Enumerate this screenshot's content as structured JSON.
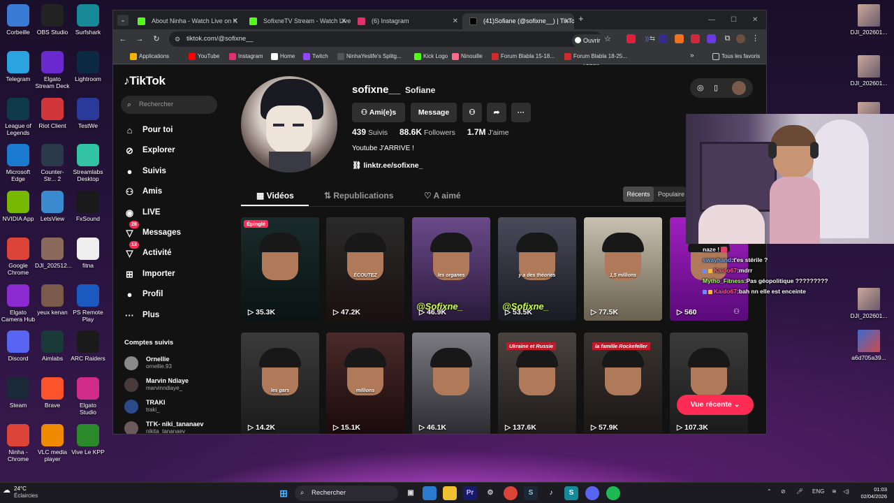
{
  "desktop_left": [
    {
      "label": "Corbeille",
      "icon": "trash-icon",
      "color": "#3a7bd5"
    },
    {
      "label": "OBS Studio",
      "icon": "obs-icon",
      "color": "#222"
    },
    {
      "label": "Surfshark",
      "icon": "surfshark-icon",
      "color": "#178a9a"
    },
    {
      "label": "Telegram",
      "icon": "telegram-icon",
      "color": "#2aa3e0"
    },
    {
      "label": "Elgato Stream Deck",
      "icon": "stream-deck-icon",
      "color": "#6a2ad0"
    },
    {
      "label": "Lightroom",
      "icon": "lightroom-icon",
      "color": "#0c2a44"
    },
    {
      "label": "League of Legends",
      "icon": "league-icon",
      "color": "#0e3a4a"
    },
    {
      "label": "Riot Client",
      "icon": "riot-icon",
      "color": "#d13639"
    },
    {
      "label": "TestWe",
      "icon": "testwe-icon",
      "color": "#2a3a9a"
    },
    {
      "label": "Microsoft Edge",
      "icon": "edge-icon",
      "color": "#1a7ad0"
    },
    {
      "label": "Counter-Str... 2",
      "icon": "cs2-icon",
      "color": "#2a3a4a"
    },
    {
      "label": "Streamlabs Desktop",
      "icon": "streamlabs-icon",
      "color": "#31c3a2"
    },
    {
      "label": "NVIDIA App",
      "icon": "nvidia-icon",
      "color": "#76b900"
    },
    {
      "label": "LetsView",
      "icon": "letsview-icon",
      "color": "#3a8ad0"
    },
    {
      "label": "FxSound",
      "icon": "fxsound-icon",
      "color": "#1a1a1a"
    },
    {
      "label": "Google Chrome",
      "icon": "chrome-icon",
      "color": "#dc4437"
    },
    {
      "label": "DJI_202512...",
      "icon": "image-file-icon",
      "color": "#8a6a5a"
    },
    {
      "label": "fitna",
      "icon": "text-file-icon",
      "color": "#eeeeee"
    },
    {
      "label": "Elgato Camera Hub",
      "icon": "camera-hub-icon",
      "color": "#8a2ad0"
    },
    {
      "label": "yeux kenan",
      "icon": "image-file-icon",
      "color": "#7a5a4a"
    },
    {
      "label": "PS Remote Play",
      "icon": "ps-remote-icon",
      "color": "#1a5ac0"
    },
    {
      "label": "Discord",
      "icon": "discord-icon",
      "color": "#5865f2"
    },
    {
      "label": "Aimlabs",
      "icon": "aimlabs-icon",
      "color": "#1a3a3a"
    },
    {
      "label": "ARC Raiders",
      "icon": "arc-raiders-icon",
      "color": "#1a1a1a"
    },
    {
      "label": "Steam",
      "icon": "steam-icon",
      "color": "#1b2838"
    },
    {
      "label": "Brave",
      "icon": "brave-icon",
      "color": "#fb542b"
    },
    {
      "label": "Elgato Studio",
      "icon": "elgato-studio-icon",
      "color": "#d02a8a"
    },
    {
      "label": "Ninha - Chrome",
      "icon": "chrome-icon",
      "color": "#dc4437"
    },
    {
      "label": "VLC media player",
      "icon": "vlc-icon",
      "color": "#f08a00"
    },
    {
      "label": "Vive Le KPP",
      "icon": "kpp-icon",
      "color": "#2a8a2a"
    }
  ],
  "desktop_right": [
    {
      "label": "DJI_202601..."
    },
    {
      "label": "DJI_202601..."
    },
    {
      "label": "DJI_202601..."
    },
    {
      "label": "DJI_202601..."
    },
    {
      "label": "a6d705a39..."
    }
  ],
  "browser": {
    "tabs": [
      {
        "title": "About Ninha - Watch Live on K",
        "color": "#53fc18"
      },
      {
        "title": "SofixneTV Stream - Watch Live",
        "color": "#53fc18"
      },
      {
        "title": "(6) Instagram",
        "color": "#e1306c"
      },
      {
        "title": "(41)Sofiane (@sofixne__) | TikTo",
        "color": "#000000"
      }
    ],
    "new_tab": "+",
    "url": "tiktok.com/@sofixne__",
    "open_app": "Ouvrir dans l'appli",
    "bookmarks": [
      {
        "label": "Applications",
        "color": "#f4b400"
      },
      {
        "label": "YouTube",
        "color": "#ff0000"
      },
      {
        "label": "Instagram",
        "color": "#e1306c"
      },
      {
        "label": "Home",
        "color": "#ffffff"
      },
      {
        "label": "Twitch",
        "color": "#9146ff"
      },
      {
        "label": "NinhaYeslife's Splitg...",
        "color": "#555555"
      },
      {
        "label": "Kick Logo",
        "color": "#53fc18"
      },
      {
        "label": "Ninouille",
        "color": "#ff6a8a"
      },
      {
        "label": "Forum Blabla 15-18...",
        "color": "#d02a2a"
      },
      {
        "label": "Forum Blabla 18-25...",
        "color": "#d02a2a"
      }
    ],
    "all_bookmarks": "Tous les favoris"
  },
  "tiktok": {
    "logo": "TikTok",
    "search_placeholder": "Rechercher",
    "nav": [
      {
        "label": "Pour toi",
        "icon": "home-icon"
      },
      {
        "label": "Explorer",
        "icon": "compass-icon"
      },
      {
        "label": "Suivis",
        "icon": "following-icon"
      },
      {
        "label": "Amis",
        "icon": "friends-icon"
      },
      {
        "label": "LIVE",
        "icon": "live-icon"
      },
      {
        "label": "Messages",
        "icon": "messages-icon",
        "badge": "28"
      },
      {
        "label": "Activité",
        "icon": "activity-icon",
        "badge": "13"
      },
      {
        "label": "Importer",
        "icon": "upload-icon"
      },
      {
        "label": "Profil",
        "icon": "profile-icon"
      },
      {
        "label": "Plus",
        "icon": "more-icon"
      }
    ],
    "followed_title": "Comptes suivis",
    "followed": [
      {
        "name": "Ornellie",
        "handle": "ornellie.93"
      },
      {
        "name": "Marvin Ndiaye",
        "handle": "marvinndiaye_"
      },
      {
        "name": "TRAKI",
        "handle": "traki_"
      },
      {
        "name": "TΓK- niki_tananaev",
        "handle": "nikita_tananaev"
      }
    ],
    "profile": {
      "username": "sofixne__",
      "nickname": "Sofiane",
      "friends_btn": "Ami(e)s",
      "message_btn": "Message",
      "following_count": "439",
      "following_label": "Suivis",
      "followers_count": "88.6K",
      "followers_label": "Followers",
      "likes_count": "1.7M",
      "likes_label": "J'aime",
      "bio": "Youtube J'ARRIVE !",
      "link": "linktr.ee/sofixne_"
    },
    "tabs": {
      "videos": "Vidéos",
      "reposts": "Republications",
      "liked": "A aimé"
    },
    "sort": {
      "recent": "Récents",
      "popular": "Populaire"
    },
    "videos": [
      {
        "views": "35.3K",
        "tag": "Épinglé",
        "caption": ""
      },
      {
        "views": "47.2K",
        "tag": "",
        "caption": "ÉCOUTEZ"
      },
      {
        "views": "46.9K",
        "tag": "",
        "caption": "les organes",
        "overlay": "@Sofixne_"
      },
      {
        "views": "53.5K",
        "tag": "",
        "caption": "y a des théories",
        "overlay": "@Sofixne_"
      },
      {
        "views": "77.5K",
        "tag": "",
        "caption": "1,5 millions"
      },
      {
        "views": "560",
        "tag": "",
        "caption": ""
      },
      {
        "views": "14.2K",
        "tag": "",
        "caption": "les gars"
      },
      {
        "views": "15.1K",
        "tag": "",
        "caption": "millions"
      },
      {
        "views": "46.1K",
        "tag": "",
        "caption": ""
      },
      {
        "views": "137.6K",
        "tag": "Ukraine et Russie",
        "caption": ""
      },
      {
        "views": "57.9K",
        "tag": "la famille Rockefeller",
        "caption": ""
      },
      {
        "views": "107.3K",
        "tag": "",
        "caption": ""
      }
    ],
    "recent_view_btn": "Vue récente"
  },
  "chat": [
    {
      "user": "",
      "msg": "naze !"
    },
    {
      "user": "swayhand",
      "msg": "t'es stérile ?"
    },
    {
      "user": "Kaido67",
      "msg": "mdrr"
    },
    {
      "user": "Mytho_Fitness",
      "msg": "Pas géopolitique ?????????"
    },
    {
      "user": "Kaido67",
      "msg": "bah nn elle est enceinte"
    }
  ],
  "taskbar": {
    "weather_temp": "24°C",
    "weather_text": "Éclaircies",
    "search": "Rechercher",
    "lang": "ENG",
    "time": "01:03",
    "date": "02/04/2026"
  }
}
